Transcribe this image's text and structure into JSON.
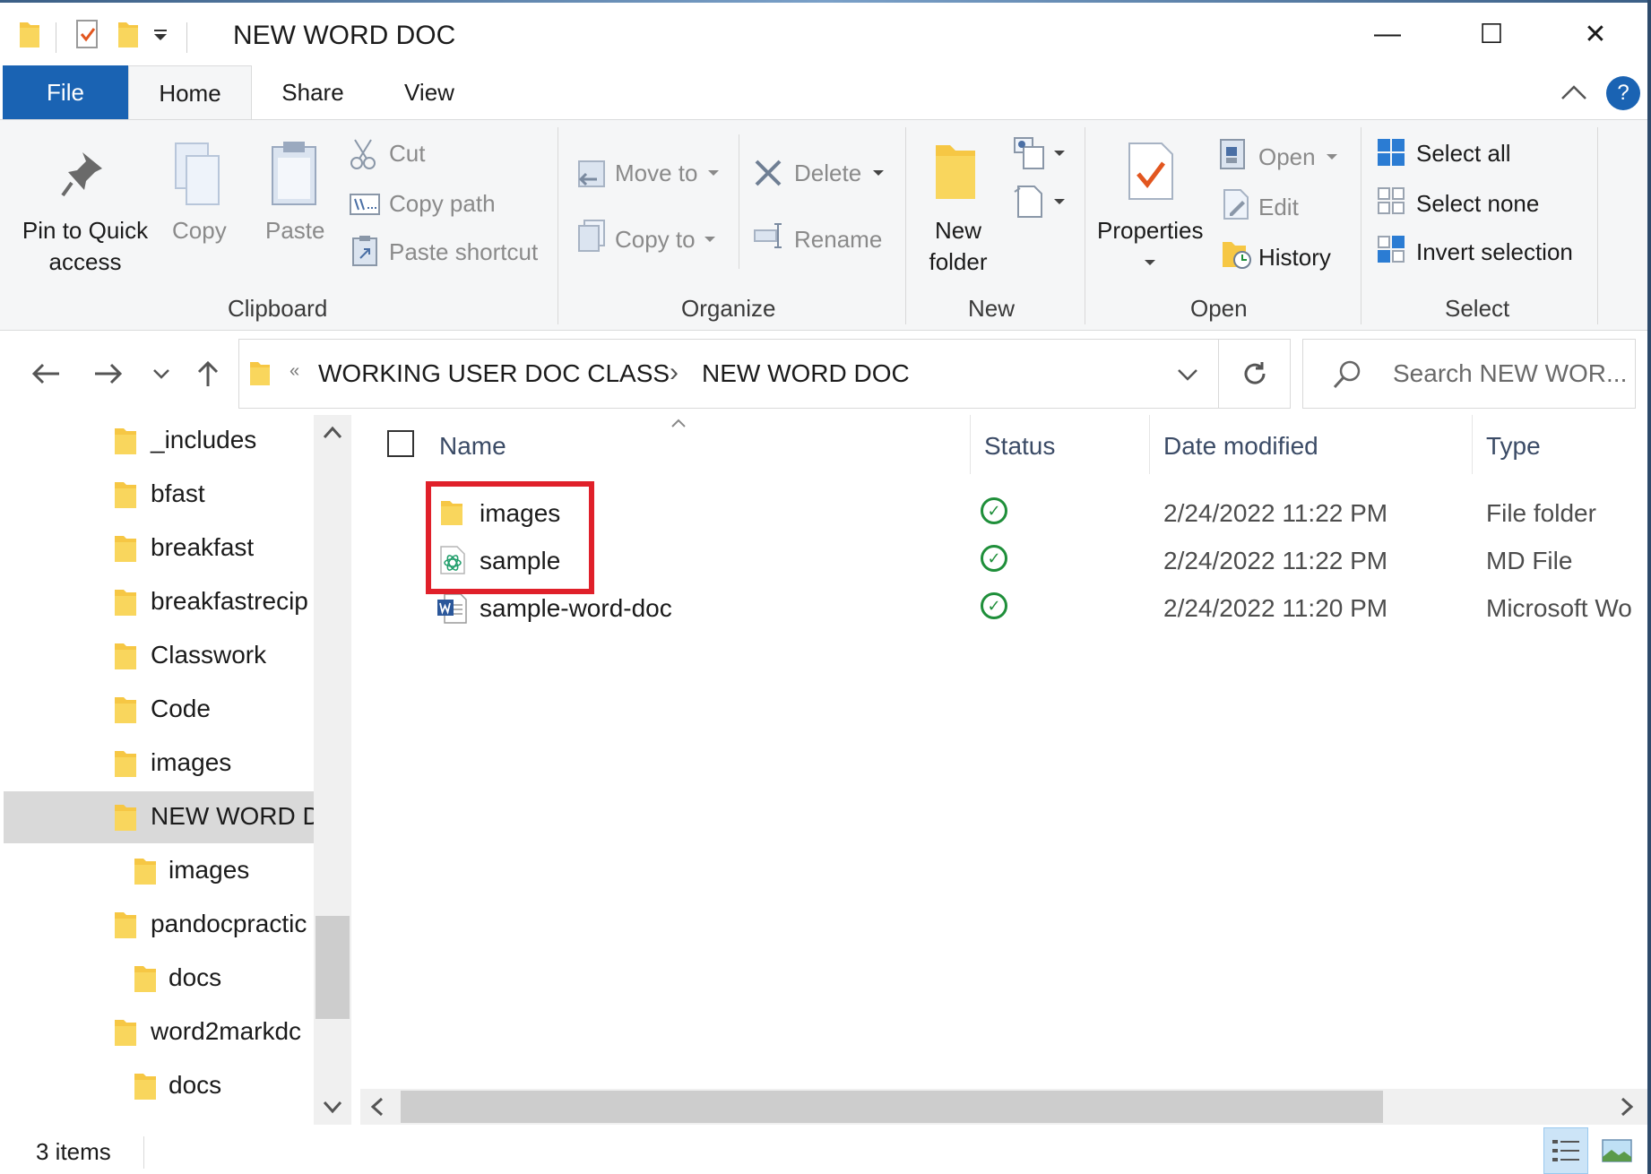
{
  "window": {
    "title": "NEW WORD DOC",
    "minimize": "—",
    "maximize": "☐",
    "close": "✕"
  },
  "ribbon_tabs": {
    "file": "File",
    "home": "Home",
    "share": "Share",
    "view": "View",
    "help": "?"
  },
  "ribbon": {
    "clipboard": {
      "label": "Clipboard",
      "pin_line1": "Pin to Quick",
      "pin_line2": "access",
      "copy": "Copy",
      "paste": "Paste",
      "cut": "Cut",
      "copy_path": "Copy path",
      "paste_shortcut": "Paste shortcut"
    },
    "organize": {
      "label": "Organize",
      "move_to": "Move to",
      "copy_to": "Copy to",
      "delete": "Delete",
      "rename": "Rename"
    },
    "new": {
      "label": "New",
      "new_folder_line1": "New",
      "new_folder_line2": "folder"
    },
    "open": {
      "label": "Open",
      "properties": "Properties",
      "open": "Open",
      "edit": "Edit",
      "history": "History"
    },
    "select": {
      "label": "Select",
      "select_all": "Select all",
      "select_none": "Select none",
      "invert_selection": "Invert selection"
    }
  },
  "address": {
    "overflow": "«",
    "crumb1": "WORKING USER DOC CLASS",
    "sep": "›",
    "crumb2": "NEW WORD DOC",
    "search_placeholder": "Search NEW WOR..."
  },
  "tree": [
    {
      "label": "_includes"
    },
    {
      "label": "bfast"
    },
    {
      "label": "breakfast"
    },
    {
      "label": "breakfastrecip"
    },
    {
      "label": "Classwork"
    },
    {
      "label": "Code"
    },
    {
      "label": "images"
    },
    {
      "label": "NEW WORD D"
    },
    {
      "label": "images"
    },
    {
      "label": "pandocpractic"
    },
    {
      "label": "docs"
    },
    {
      "label": "word2markdc"
    },
    {
      "label": "docs"
    }
  ],
  "columns": {
    "name": "Name",
    "status": "Status",
    "date": "Date modified",
    "type": "Type"
  },
  "files": [
    {
      "name": "images",
      "status": "✓",
      "date": "2/24/2022 11:22 PM",
      "type": "File folder"
    },
    {
      "name": "sample",
      "status": "✓",
      "date": "2/24/2022 11:22 PM",
      "type": "MD File"
    },
    {
      "name": "sample-word-doc",
      "status": "✓",
      "date": "2/24/2022 11:20 PM",
      "type": "Microsoft Wo"
    }
  ],
  "status_bar": {
    "item_count": "3 items"
  },
  "colors": {
    "file_tab": "#1a63b3",
    "folder": "#f6c744",
    "highlight_box": "#e0202a",
    "status_ok": "#1f8f3a"
  }
}
